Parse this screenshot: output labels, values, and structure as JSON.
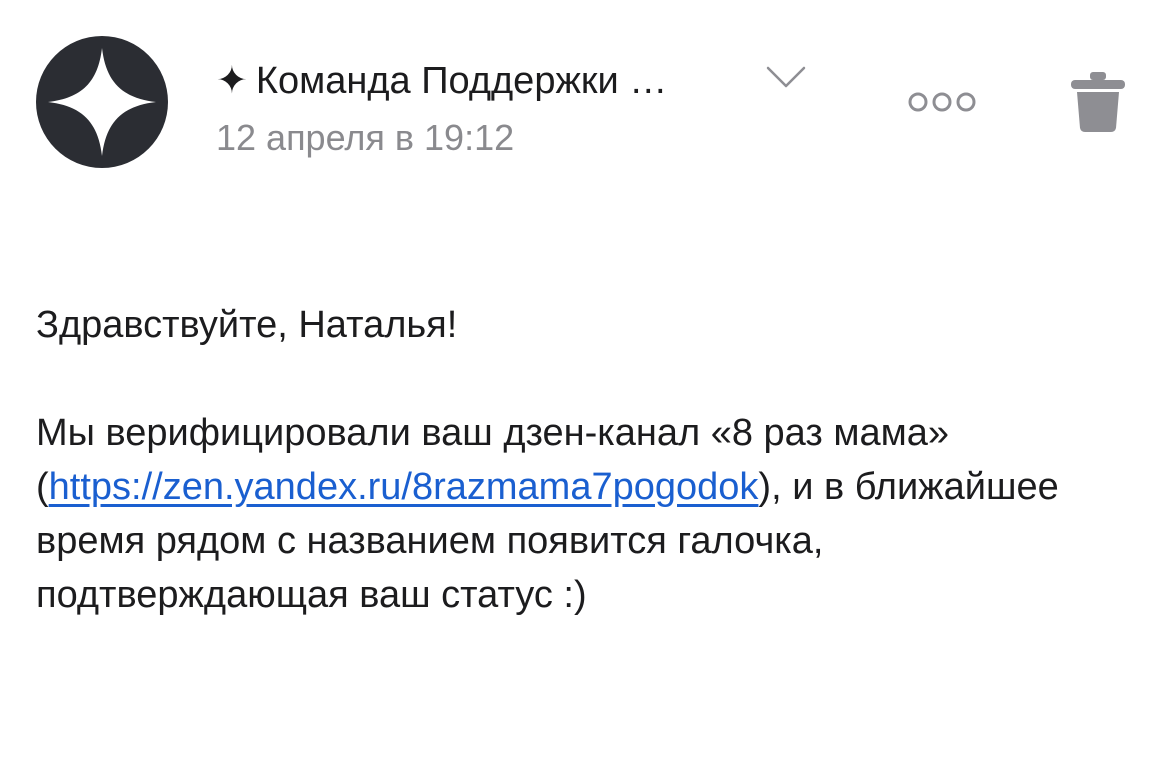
{
  "header": {
    "avatar_icon": "zen-star-icon",
    "sender_prefix_icon": "sparkle-icon",
    "sender_name": "Команда Поддержки …",
    "date": "12 апреля в 19:12",
    "expand_icon": "chevron-down-icon",
    "more_icon": "more-dots-icon",
    "delete_icon": "trash-icon"
  },
  "message": {
    "greeting": "Здравствуйте, Наталья!",
    "paragraph_start": "Мы верифицировали ваш дзен-канал «8 раз мама» (",
    "link_text": "https://zen.yandex.ru/8razmama7pogodok",
    "paragraph_end": "), и в ближайшее время рядом с названием появится галочка, подтверждающая ваш статус :)"
  },
  "colors": {
    "avatar_bg": "#2b2d33",
    "text": "#1c1c1e",
    "secondary_text": "#8a8a8e",
    "link": "#1a5fd0",
    "icon_gray": "#8e8e93"
  }
}
